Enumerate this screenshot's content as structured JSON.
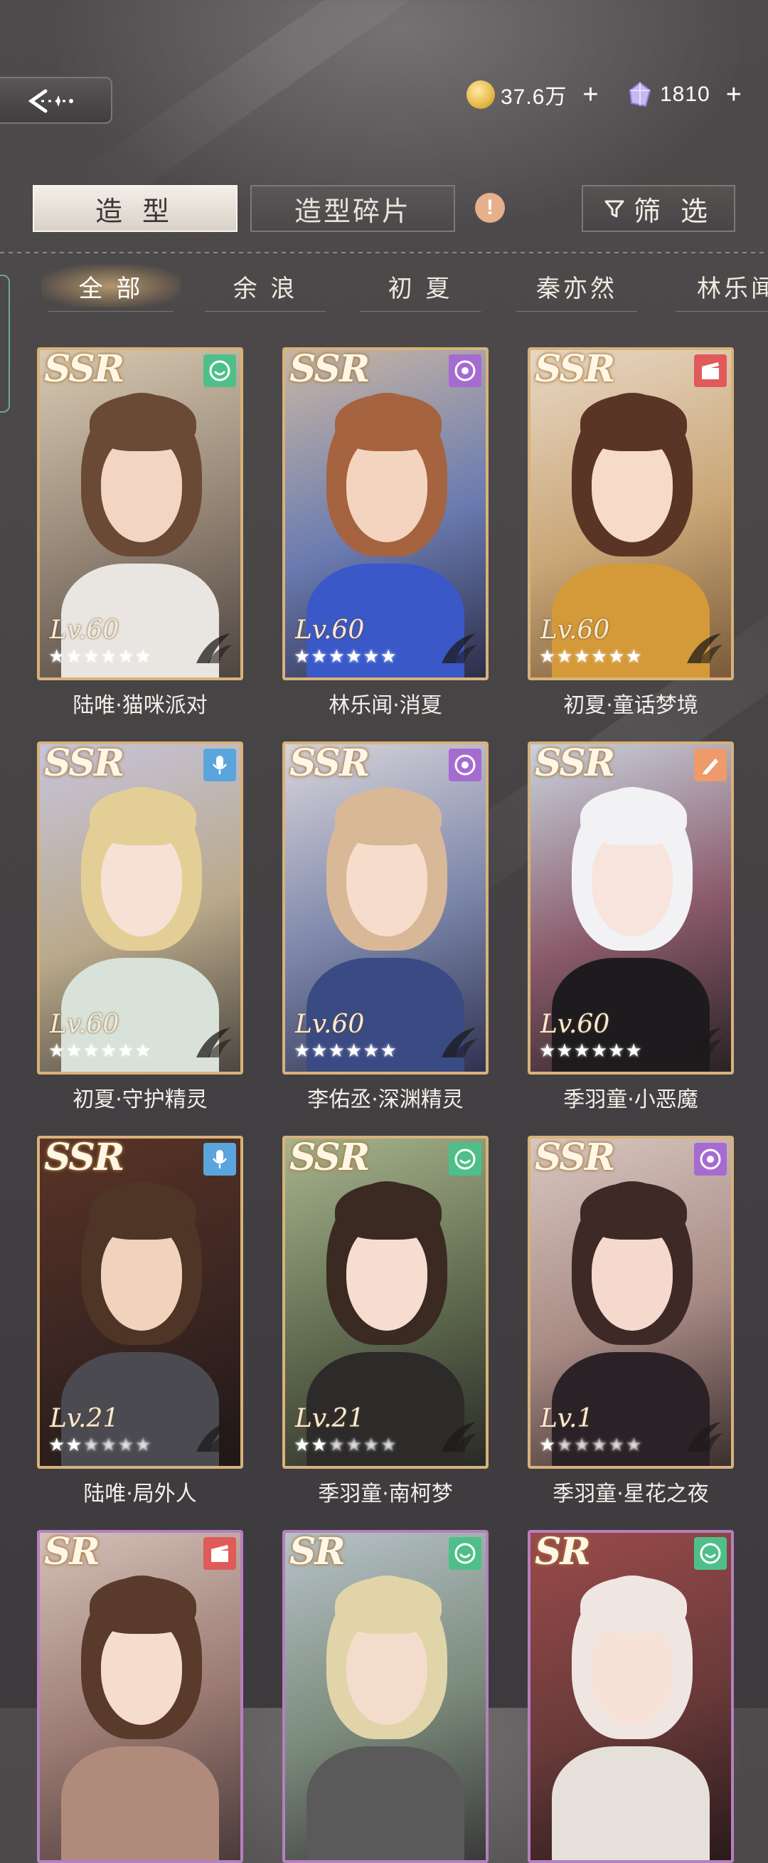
{
  "header": {
    "gold": {
      "icon": "gold-coin-icon",
      "value": "37.6万"
    },
    "gem": {
      "icon": "diamond-icon",
      "value": "1810"
    },
    "plus": "+"
  },
  "tabs": {
    "styles": "造 型",
    "fragments": "造型碎片",
    "alert": "!",
    "filter": "筛 选"
  },
  "characters": [
    "全 部",
    "余 浪",
    "初 夏",
    "秦亦然",
    "林乐闻"
  ],
  "cards": [
    {
      "rarity": "SSR",
      "level": "Lv.60",
      "stars": 6,
      "name": "陆唯·猫咪派对",
      "icon": "smile-icon",
      "icon_color": "#4fbf8a"
    },
    {
      "rarity": "SSR",
      "level": "Lv.60",
      "stars": 6,
      "name": "林乐闻·消夏",
      "icon": "vinyl-icon",
      "icon_color": "#a66bd0"
    },
    {
      "rarity": "SSR",
      "level": "Lv.60",
      "stars": 6,
      "name": "初夏·童话梦境",
      "icon": "clapper-icon",
      "icon_color": "#e05a5a"
    },
    {
      "rarity": "SSR",
      "level": "Lv.60",
      "stars": 6,
      "name": "初夏·守护精灵",
      "icon": "microphone-icon",
      "icon_color": "#5aa5dc"
    },
    {
      "rarity": "SSR",
      "level": "Lv.60",
      "stars": 6,
      "name": "李佑丞·深渊精灵",
      "icon": "vinyl-icon",
      "icon_color": "#a66bd0"
    },
    {
      "rarity": "SSR",
      "level": "Lv.60",
      "stars": 6,
      "name": "季羽童·小恶魔",
      "icon": "pen-icon",
      "icon_color": "#ef9a6a"
    },
    {
      "rarity": "SSR",
      "level": "Lv.21",
      "stars": 2,
      "name": "陆唯·局外人",
      "icon": "microphone-icon",
      "icon_color": "#5aa5dc"
    },
    {
      "rarity": "SSR",
      "level": "Lv.21",
      "stars": 2,
      "name": "季羽童·南柯梦",
      "icon": "smile-icon",
      "icon_color": "#4fbf8a"
    },
    {
      "rarity": "SSR",
      "level": "Lv.1",
      "stars": 1,
      "name": "季羽童·星花之夜",
      "icon": "vinyl-icon",
      "icon_color": "#a66bd0"
    },
    {
      "rarity": "SR",
      "level": "",
      "stars": 0,
      "name": "",
      "icon": "clapper-icon",
      "icon_color": "#e05a5a"
    },
    {
      "rarity": "SR",
      "level": "",
      "stars": 0,
      "name": "",
      "icon": "smile-icon",
      "icon_color": "#4fbf8a"
    },
    {
      "rarity": "SR",
      "level": "",
      "stars": 0,
      "name": "",
      "icon": "smile-icon",
      "icon_color": "#4fbf8a"
    }
  ]
}
